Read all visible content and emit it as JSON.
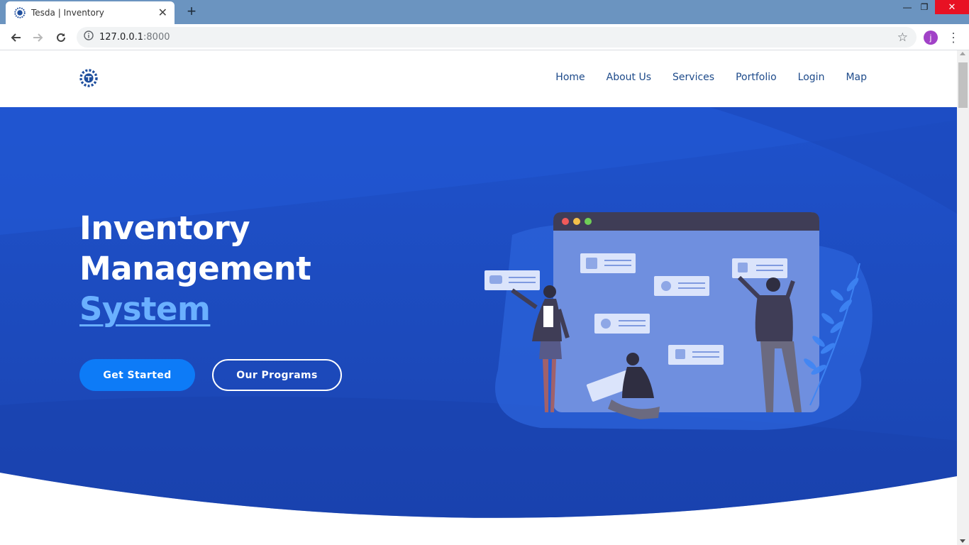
{
  "browser": {
    "tab_title": "Tesda | Inventory",
    "url_host": "127.0.0.1",
    "url_port": ":8000",
    "profile_initial": "j"
  },
  "site": {
    "nav": [
      "Home",
      "About Us",
      "Services",
      "Portfolio",
      "Login",
      "Map"
    ],
    "hero": {
      "title_line1": "Inventory",
      "title_line2": "Management",
      "title_accent": "System",
      "primary_button": "Get Started",
      "secondary_button": "Our Programs"
    }
  },
  "colors": {
    "hero_blue": "#1c4fc5",
    "hero_blue_dark": "#1a44b2",
    "accent": "#6ab0ff",
    "button_primary": "#0d7bf7",
    "nav_link": "#1d4a8a"
  }
}
